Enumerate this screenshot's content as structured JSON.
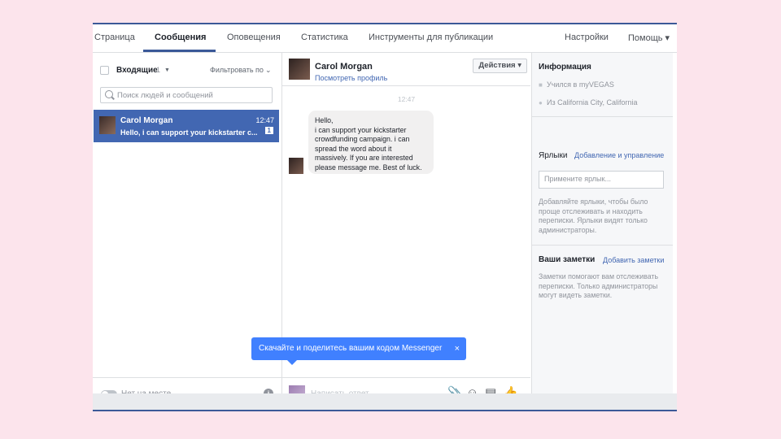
{
  "nav": {
    "items": [
      "Страница",
      "Сообщения",
      "Оповещения",
      "Статистика",
      "Инструменты для публикации"
    ],
    "settings": "Настройки",
    "help": "Помощь ▾"
  },
  "inbox": {
    "label": "Входящие",
    "count": "1",
    "filter": "Фильтровать по",
    "search_placeholder": "Поиск людей и сообщений"
  },
  "conversation": {
    "name": "Carol Morgan",
    "time": "12:47",
    "snippet": "Hello, i can support your kickstarter c...",
    "unread": "1"
  },
  "footer_left": {
    "status": "Нет на месте"
  },
  "thread": {
    "name": "Carol Morgan",
    "profile_link": "Посмотреть профиль",
    "actions": "Действия ▾",
    "timestamp": "12:47",
    "message_lines": [
      "Hello,",
      "i can support your kickstarter",
      "crowdfunding campaign. i can",
      "spread the word about it",
      "massively. If you are interested",
      "please message me. Best of luck."
    ],
    "reply_placeholder": "Написать ответ..."
  },
  "tooltip": {
    "text": "Скачайте и поделитесь вашим кодом Messenger",
    "close": "×"
  },
  "info": {
    "title": "Информация",
    "study": "Учился в myVEGAS",
    "location": "Из California City, California",
    "labels_title": "Ярлыки",
    "labels_link": "Добавление и управление",
    "labels_placeholder": "Примените ярлык...",
    "labels_help_lines": [
      "Добавляйте ярлыки, чтобы было",
      "проще отслеживать и находить",
      "переписки. Ярлыки видят только",
      "администраторы."
    ],
    "notes_title": "Ваши заметки",
    "notes_link": "Добавить заметки",
    "notes_help_lines": [
      "Заметки помогают вам отслеживать",
      "переписки. Только администраторы",
      "могут видеть заметки."
    ]
  },
  "colors": {
    "accent": "#4267b2",
    "tooltip": "#4080ff",
    "background": "#fce4ec"
  }
}
